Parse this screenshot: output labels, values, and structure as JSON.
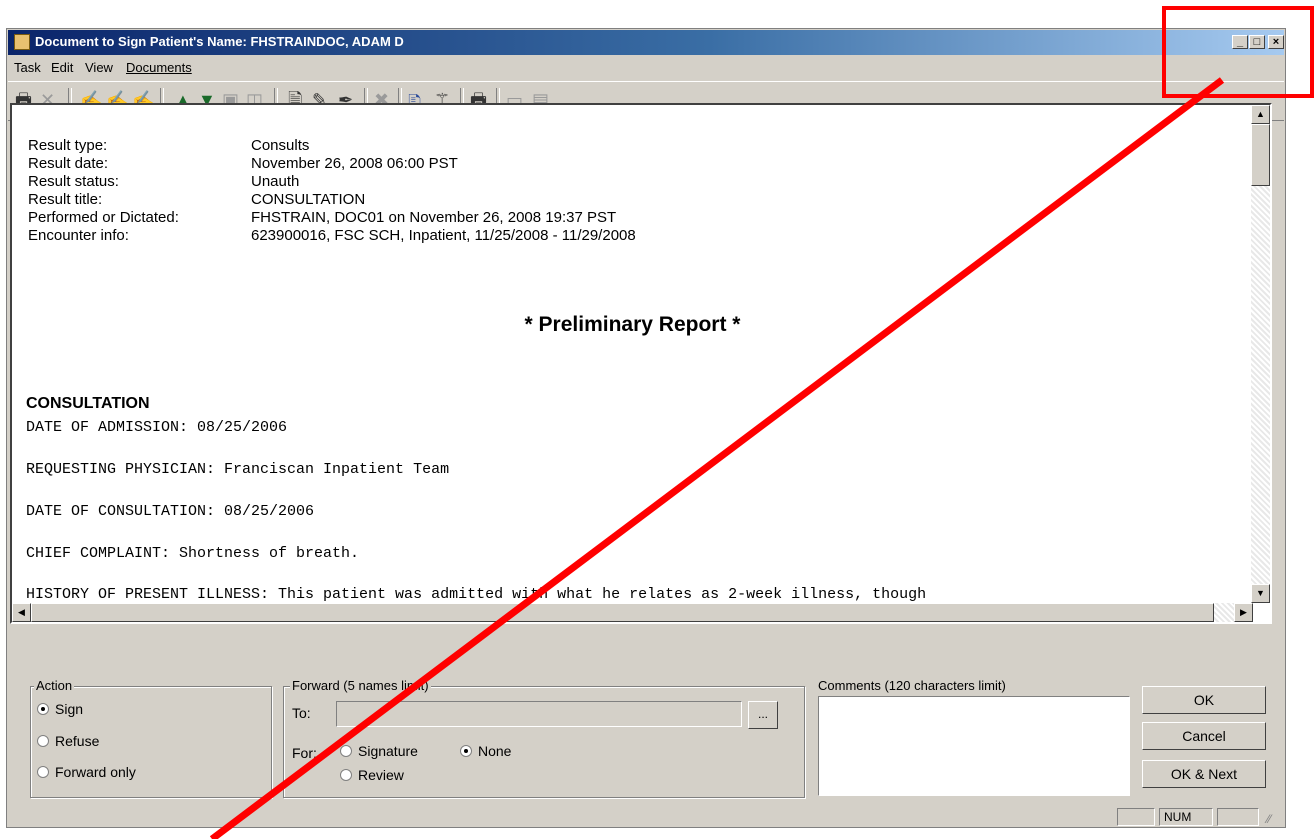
{
  "window": {
    "title": "Document to Sign    Patient's Name: FHSTRAINDOC, ADAM D",
    "controls": {
      "minimize": "_",
      "maximize": "□",
      "close": "×"
    }
  },
  "menu": [
    "Task",
    "Edit",
    "View",
    "Documents"
  ],
  "toolbar_icons": [
    "print-icon",
    "delete-icon",
    "sign-icon",
    "refuse-icon",
    "forward-icon",
    "up-arrow-icon",
    "down-arrow-icon",
    "paste-icon",
    "copy-icon",
    "new-note-icon",
    "pen-icon",
    "signature-icon",
    "cancel-icon",
    "edit-document-icon",
    "wand-icon",
    "print2-icon",
    "monitor-icon",
    "layers-icon"
  ],
  "document": {
    "fields": [
      {
        "label": "Result type:",
        "value": "Consults"
      },
      {
        "label": "Result date:",
        "value": "November 26, 2008 06:00 PST"
      },
      {
        "label": "Result status:",
        "value": "Unauth"
      },
      {
        "label": "Result title:",
        "value": "CONSULTATION"
      },
      {
        "label": "Performed or Dictated:",
        "value": "FHSTRAIN, DOC01 on November 26, 2008 19:37 PST"
      },
      {
        "label": "Encounter info:",
        "value": "623900016, FSC SCH, Inpatient, 11/25/2008 - 11/29/2008"
      }
    ],
    "preliminary": "* Preliminary Report *",
    "consult_heading": "CONSULTATION",
    "lines": [
      "DATE OF ADMISSION:  08/25/2006",
      "REQUESTING PHYSICIAN:  Franciscan Inpatient Team",
      "DATE OF CONSULTATION:  08/25/2006",
      "CHIEF COMPLAINT:  Shortness of breath.",
      "HISTORY OF PRESENT ILLNESS:  This patient was admitted with what he relates as 2-week illness, though"
    ]
  },
  "action": {
    "label": "Action",
    "options": [
      "Sign",
      "Refuse",
      "Forward only"
    ],
    "selected": "Sign"
  },
  "forward": {
    "label": "Forward (5 names limit)",
    "to_label": "To:",
    "to_value": "",
    "browse_label": "...",
    "for_label": "For:",
    "options": [
      "Signature",
      "None",
      "Review"
    ],
    "selected": "None"
  },
  "comments": {
    "label": "Comments (120 characters limit)",
    "value": ""
  },
  "buttons": {
    "ok": "OK",
    "cancel": "Cancel",
    "ok_next": "OK & Next"
  },
  "status": {
    "num": "NUM"
  },
  "annotation_color": "#ff0000"
}
